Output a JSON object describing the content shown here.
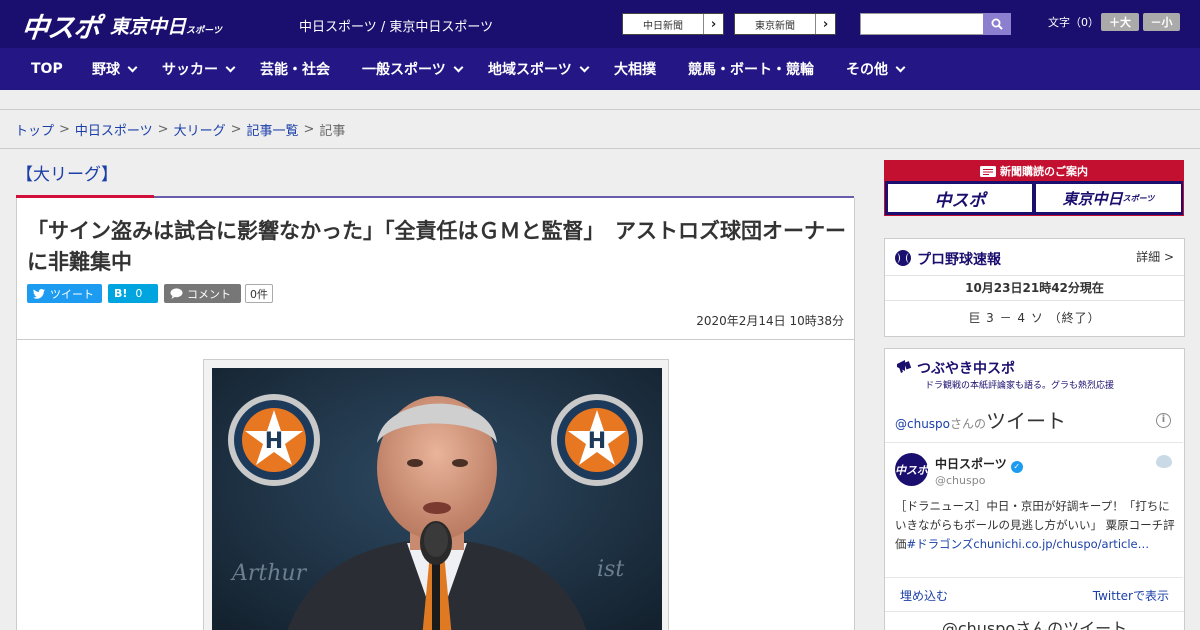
{
  "header": {
    "logo_chuspo": "中スポ",
    "logo_tokyo": "東京中日",
    "logo_tokyo_sub": "スポーツ",
    "site_title": "中日スポーツ / 東京中日スポーツ",
    "paper_buttons": [
      "中日新聞",
      "東京新聞"
    ],
    "search": {
      "placeholder": ""
    },
    "font_size_label": "文字（0）",
    "font_plus": "＋大",
    "font_minus": "－小"
  },
  "nav": [
    {
      "label": "TOP",
      "has_menu": false
    },
    {
      "label": "野球",
      "has_menu": true
    },
    {
      "label": "サッカー",
      "has_menu": true
    },
    {
      "label": "芸能・社会",
      "has_menu": false
    },
    {
      "label": "一般スポーツ",
      "has_menu": true
    },
    {
      "label": "地域スポーツ",
      "has_menu": true
    },
    {
      "label": "大相撲",
      "has_menu": false
    },
    {
      "label": "競馬・ボート・競輪",
      "has_menu": false
    },
    {
      "label": "その他",
      "has_menu": true
    }
  ],
  "breadcrumb": [
    "トップ",
    "中日スポーツ",
    "大リーグ",
    "記事一覧",
    "記事"
  ],
  "article": {
    "category": "【大リーグ】",
    "headline": "「サイン盗みは試合に影響なかった」「全責任はＧＭと監督」　アストロズ球団オーナーに非難集中",
    "tweet_label": "ツイート",
    "hatena_label": "B!",
    "hatena_count": "0",
    "comment_label": "コメント",
    "comment_count": "0件",
    "date": "2020年2月14日 10時38分"
  },
  "sidebar": {
    "subscribe": {
      "title": "新聞購読のご案内",
      "logo_chuspo": "中スポ",
      "logo_tokyo": "東京中日",
      "logo_tokyo_sub": "スポーツ"
    },
    "baseball": {
      "title": "プロ野球速報",
      "more": "詳細 >",
      "updated": "10月23日21時42分現在",
      "score": "巨 3 － 4 ソ （終了）"
    },
    "tsubuyaki": {
      "title": "つぶやき中スポ",
      "subtitle": "ドラ観戦の本紙評論家も語る。グラも熱烈応援",
      "handle_prefix": "@chuspo",
      "handle_suffix": "さんの",
      "tweets_label": "ツイート",
      "account_name": "中日スポーツ",
      "account_handle": "@chuspo",
      "avatar_text": "中スポ",
      "tweet_text": "［ドラニュース］中日・京田が好調キープ！「打ちにいきながらもボールの見逃し方がいい」 粟原コーチ評価",
      "tweet_link": "#ドラゴンズchunichi.co.jp/chuspo/article…",
      "embed": "埋め込む",
      "view_on_twitter": "Twitterで表示",
      "next_header": "@chuspoさんのツイート"
    }
  },
  "colors": {
    "header_bg": "#1a0f6e",
    "nav_bg": "#241785",
    "accent_red": "#d0103a",
    "link_blue": "#1a3fa8",
    "twitter_blue": "#1d9bf0"
  }
}
